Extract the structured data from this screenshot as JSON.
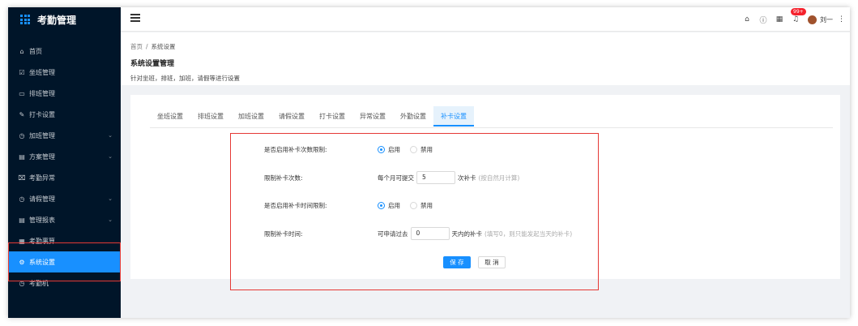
{
  "app": {
    "title": "考勤管理"
  },
  "sidebar": {
    "items": [
      {
        "label": "首页",
        "icon": "home-icon",
        "glyph": "⌂",
        "arrow": false
      },
      {
        "label": "坐班管理",
        "icon": "checkbox-icon",
        "glyph": "☑",
        "arrow": false
      },
      {
        "label": "排班管理",
        "icon": "keyboard-icon",
        "glyph": "▭",
        "arrow": false
      },
      {
        "label": "打卡设置",
        "icon": "edit-icon",
        "glyph": "✎",
        "arrow": false
      },
      {
        "label": "加班管理",
        "icon": "clock-icon",
        "glyph": "◷",
        "arrow": true
      },
      {
        "label": "方案管理",
        "icon": "document-icon",
        "glyph": "▤",
        "arrow": true
      },
      {
        "label": "考勤异常",
        "icon": "delete-icon",
        "glyph": "⌧",
        "arrow": false
      },
      {
        "label": "请假管理",
        "icon": "clock-icon",
        "glyph": "◷",
        "arrow": true
      },
      {
        "label": "管理报表",
        "icon": "report-icon",
        "glyph": "▤",
        "arrow": true
      },
      {
        "label": "考勤裹算",
        "icon": "calculator-icon",
        "glyph": "▦",
        "arrow": false
      },
      {
        "label": "系统设置",
        "icon": "gear-icon",
        "glyph": "⚙",
        "arrow": false,
        "active": true
      },
      {
        "label": "考勤机",
        "icon": "clock-icon",
        "glyph": "◷",
        "arrow": false
      }
    ],
    "arrow_glyph": "⌄"
  },
  "header": {
    "badge": "99+",
    "user_name": "刘一",
    "icons": [
      "home-icon",
      "help-icon",
      "apps-icon",
      "bell-icon",
      "more-icon"
    ]
  },
  "breadcrumb": {
    "home": "首页",
    "sep": "/",
    "current": "系统设置"
  },
  "page": {
    "title": "系统设置管理",
    "description": "针对坐班，排班，加班，请假等进行设置"
  },
  "tabs": [
    {
      "label": "坐班设置"
    },
    {
      "label": "排班设置"
    },
    {
      "label": "加班设置"
    },
    {
      "label": "请假设置"
    },
    {
      "label": "打卡设置"
    },
    {
      "label": "异常设置"
    },
    {
      "label": "外勤设置"
    },
    {
      "label": "补卡设置",
      "active": true
    }
  ],
  "form": {
    "row1": {
      "label": "是否启用补卡次数限制:",
      "enable": "启用",
      "disable": "禁用",
      "selected": "enable"
    },
    "row2": {
      "label": "限制补卡次数:",
      "prefix": "每个月可提交",
      "value": "5",
      "suffix": "次补卡",
      "hint": "(按自然月计算)"
    },
    "row3": {
      "label": "是否启用补卡时间限制:",
      "enable": "启用",
      "disable": "禁用",
      "selected": "enable"
    },
    "row4": {
      "label": "限制补卡时间:",
      "prefix": "可申请过去",
      "value": "0",
      "suffix": "天内的补卡",
      "hint": "(填写0，则只能发起当天的补卡)"
    },
    "save": "保 存",
    "cancel": "取 消"
  },
  "annotation_color": "#e53935",
  "accent_color": "#1890ff"
}
